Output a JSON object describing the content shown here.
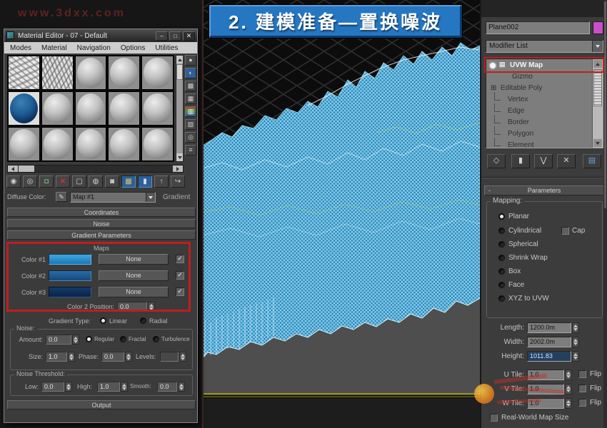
{
  "watermark": {
    "text": "www.3dxx.com"
  },
  "title_banner": {
    "text": "2. 建模准备—置换噪波"
  },
  "colors": {
    "annotation_red": "#c21d1d",
    "banner_blue": "#2577c2",
    "gradient_color1": "#2a93d4",
    "gradient_color2": "#1d5b96",
    "gradient_color3": "#0e2f5a",
    "object_color": "#c94fc9",
    "terrain_wire": "#5bbde8"
  },
  "icons": {
    "minimize": "–",
    "maximize": "□",
    "close": "✕",
    "check": "✓",
    "pick": "✎",
    "uvw_map": "▤",
    "editable_poly": "⊞",
    "toolbar": [
      "◉",
      "◎",
      "◘",
      "✕",
      "▢",
      "◍",
      "◙",
      "▩",
      "▮",
      "↑",
      "↪"
    ],
    "side": [
      "●",
      "◐",
      "▩",
      "▦",
      "▥",
      "▧",
      "◎",
      "≡"
    ],
    "stack_toolbar": [
      "◇",
      "▮",
      "⋁",
      "✕",
      "▤"
    ]
  },
  "material_editor": {
    "title": "Material Editor - 07 - Default",
    "menus": [
      "Modes",
      "Material",
      "Navigation",
      "Options",
      "Utilities"
    ],
    "diffuse_label": "Diffuse Color:",
    "map_select": "Map #1",
    "type_button": "Gradient",
    "rollouts": {
      "coordinates": "Coordinates",
      "noise": "Noise",
      "gradient": "Gradient Parameters",
      "output": "Output"
    },
    "gradient": {
      "maps_label": "Maps",
      "rows": [
        {
          "label": "Color #1",
          "button": "None"
        },
        {
          "label": "Color #2",
          "button": "None"
        },
        {
          "label": "Color #3",
          "button": "None"
        }
      ],
      "position_label": "Color 2 Position:",
      "position_value": "0.0",
      "type_label": "Gradient Type:",
      "linear": "Linear",
      "radial": "Radial"
    },
    "noise": {
      "group_label": "Noise:",
      "amount_label": "Amount:",
      "amount": "0.0",
      "regular": "Regular",
      "fractal": "Fractal",
      "turbulence": "Turbulence",
      "size_label": "Size:",
      "size": "1.0",
      "phase_label": "Phase:",
      "phase": "0.0",
      "levels_label": "Levels:",
      "levels": ""
    },
    "threshold": {
      "group_label": "Noise Threshold:",
      "low_label": "Low:",
      "low": "0.0",
      "high_label": "High:",
      "high": "1.0",
      "smooth_label": "Smooth:",
      "smooth": "0.0"
    }
  },
  "command_panel": {
    "object_name": "Plane002",
    "modifier_list": "Modifier List",
    "stack": [
      "UVW Map",
      "Gizmo",
      "Editable Poly",
      "Vertex",
      "Edge",
      "Border",
      "Polygon",
      "Element"
    ],
    "parameters_title": "Parameters",
    "mapping": {
      "group_label": "Mapping:",
      "planar": "Planar",
      "cylindrical": "Cylindrical",
      "cap": "Cap",
      "spherical": "Spherical",
      "shrink_wrap": "Shrink Wrap",
      "box": "Box",
      "face": "Face",
      "xyz": "XYZ to UVW"
    },
    "dims": {
      "length_label": "Length:",
      "length": "1200.0m",
      "width_label": "Width:",
      "width": "2002.0m",
      "height_label": "Height:",
      "height": "1011.83"
    },
    "tiles": {
      "u_label": "U Tile:",
      "u": "1.0",
      "v_label": "V Tile:",
      "v": "1.0",
      "w_label": "W Tile:",
      "w": "1.0",
      "flip": "Flip"
    },
    "real_world": "Real-World Map Size"
  }
}
